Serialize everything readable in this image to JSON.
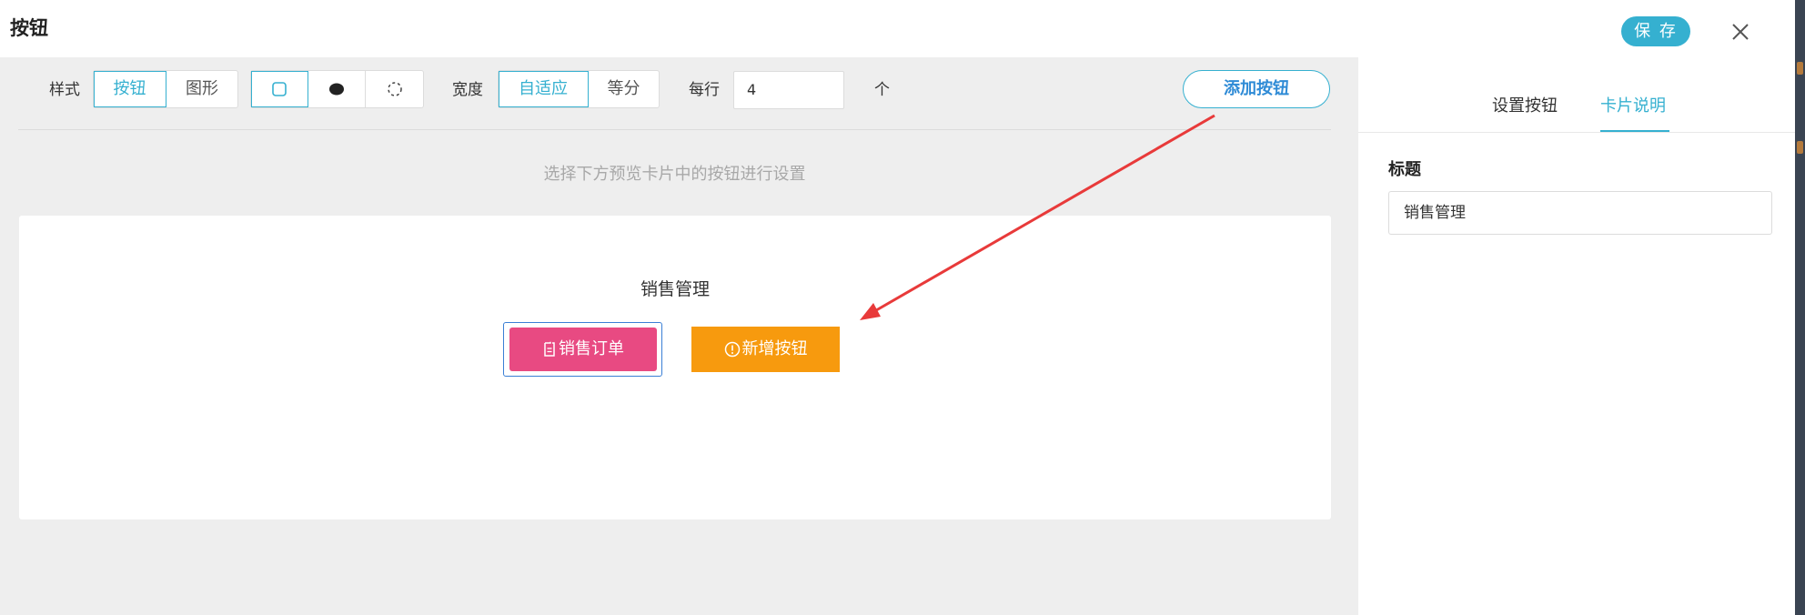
{
  "header": {
    "title": "按钮",
    "save_label": "保 存",
    "close_icon": "close-icon"
  },
  "toolbar": {
    "style_label": "样式",
    "style_options": [
      "按钮",
      "图形"
    ],
    "style_selected": "按钮",
    "shape_options": [
      "rounded-square-icon",
      "filled-circle-icon",
      "dashed-circle-icon"
    ],
    "shape_selected": "rounded-square-icon",
    "width_label": "宽度",
    "width_options": [
      "自适应",
      "等分"
    ],
    "width_selected": "自适应",
    "per_row_label": "每行",
    "per_row_value": "4",
    "per_row_unit": "个",
    "add_button_label": "添加按钮"
  },
  "preview": {
    "hint": "选择下方预览卡片中的按钮进行设置",
    "card_title": "销售管理",
    "buttons": [
      {
        "label": "销售订单",
        "icon": "document-icon",
        "color": "#e84a82",
        "selected": true
      },
      {
        "label": "新增按钮",
        "icon": "alert-circle-icon",
        "color": "#f79a0e",
        "selected": false
      }
    ]
  },
  "right_panel": {
    "tabs": [
      {
        "label": "设置按钮",
        "active": false
      },
      {
        "label": "卡片说明",
        "active": true
      }
    ],
    "field_label": "标题",
    "title_value": "销售管理"
  },
  "colors": {
    "accent": "#35b0d0",
    "arrow": "#e83a3a"
  }
}
